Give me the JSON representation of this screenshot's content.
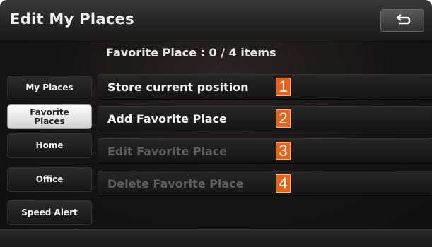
{
  "header": {
    "title": "Edit My Places",
    "back_icon": "return-arrow-icon"
  },
  "summary": {
    "favorite_count_text": "Favorite Place : 0 / 4 items"
  },
  "sidebar": {
    "items": [
      {
        "label": "My Places",
        "active": false
      },
      {
        "label": "Favorite Places",
        "active": true
      },
      {
        "label": "Home",
        "active": false
      },
      {
        "label": "Office",
        "active": false
      },
      {
        "label": "Speed Alert",
        "active": false
      }
    ]
  },
  "menu": {
    "items": [
      {
        "label": "Store current position",
        "enabled": true
      },
      {
        "label": "Add Favorite Place",
        "enabled": true
      },
      {
        "label": "Edit Favorite Place",
        "enabled": false
      },
      {
        "label": "Delete Favorite Place",
        "enabled": false
      }
    ]
  },
  "callouts": [
    "1",
    "2",
    "3",
    "4"
  ],
  "colors": {
    "callout": "#e8631a",
    "active_tab": "#ffffff",
    "disabled_text": "#5e5e5e"
  }
}
